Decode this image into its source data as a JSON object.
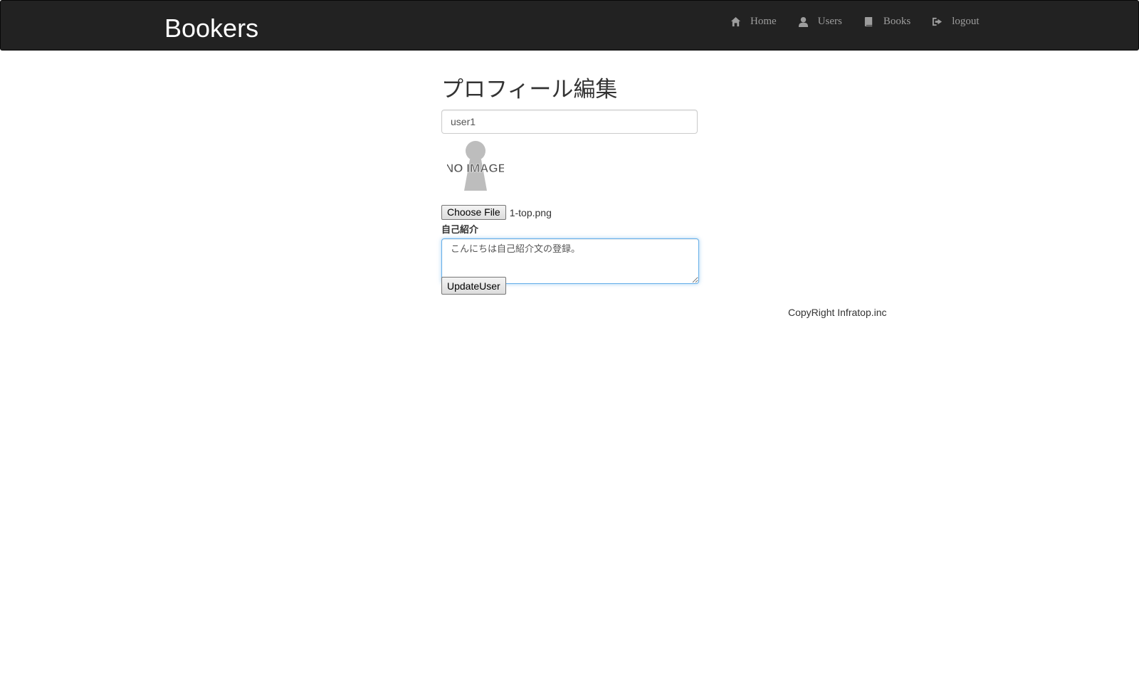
{
  "navbar": {
    "brand": "Bookers",
    "items": [
      {
        "label": "Home",
        "icon": "home-icon"
      },
      {
        "label": "Users",
        "icon": "user-icon"
      },
      {
        "label": "Books",
        "icon": "book-icon"
      },
      {
        "label": "logout",
        "icon": "logout-icon"
      }
    ]
  },
  "page": {
    "title": "プロフィール編集"
  },
  "form": {
    "name_value": "user1",
    "profile_image_alt": "NO IMAGE",
    "file_button_label": "Choose File",
    "file_name": "1-top.png",
    "intro_label": "自己紹介",
    "intro_value": "こんにちは自己紹介文の登録。",
    "submit_label": "UpdateUser"
  },
  "footer": {
    "copyright": "CopyRight Infratop.inc"
  },
  "colors": {
    "navbar_bg": "#222222",
    "nav_text": "#9d9d9d",
    "focus_border": "#66afe9"
  }
}
